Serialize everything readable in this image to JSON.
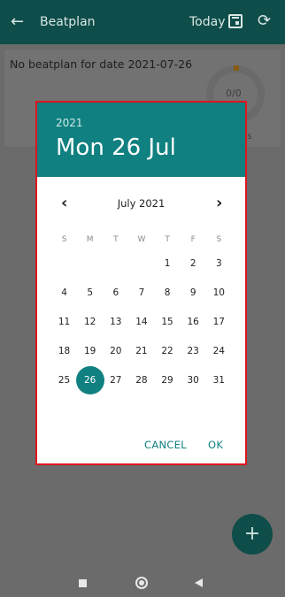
{
  "appbar": {
    "title": "Beatplan",
    "today_label": "Today",
    "icons": [
      "back-arrow-icon",
      "calendar-icon",
      "sync-icon"
    ]
  },
  "card": {
    "message": "No beatplan for date 2021-07-26",
    "progress_text": "0/0",
    "subtext": "us"
  },
  "dialog": {
    "year": "2021",
    "selected_date": "Mon 26 Jul",
    "month_label": "July 2021",
    "prev_icon": "‹",
    "next_icon": "›",
    "weekdays": [
      "S",
      "M",
      "T",
      "W",
      "T",
      "F",
      "S"
    ],
    "weeks": [
      [
        "",
        "",
        "",
        "",
        "1",
        "2",
        "3"
      ],
      [
        "4",
        "5",
        "6",
        "7",
        "8",
        "9",
        "10"
      ],
      [
        "11",
        "12",
        "13",
        "14",
        "15",
        "16",
        "17"
      ],
      [
        "18",
        "19",
        "20",
        "21",
        "22",
        "23",
        "24"
      ],
      [
        "25",
        "26",
        "27",
        "28",
        "29",
        "30",
        "31"
      ]
    ],
    "selected_day": "26",
    "cancel_label": "CANCEL",
    "ok_label": "OK"
  },
  "fab": {
    "label": "+"
  },
  "colors": {
    "accent": "#108080",
    "appbar": "#0e4d49",
    "highlight_border": "#e0141e"
  }
}
